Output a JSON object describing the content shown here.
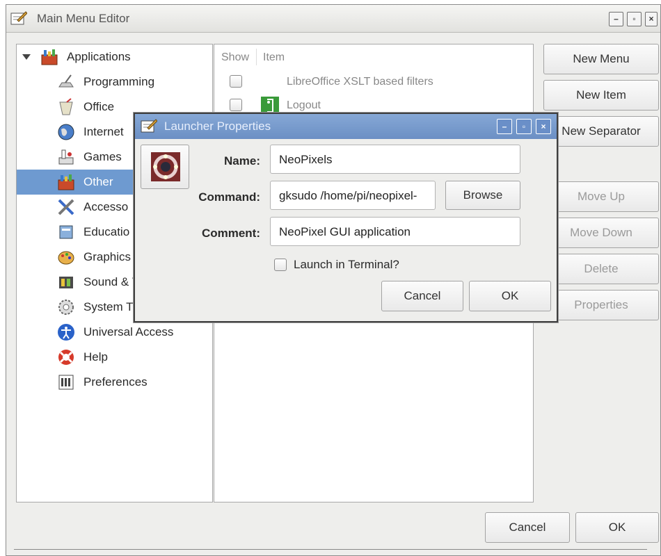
{
  "main_window": {
    "title": "Main Menu Editor",
    "controls": {
      "minimize": "–",
      "maximize": "▫",
      "close": "×"
    }
  },
  "tree": {
    "root": "Applications",
    "items": [
      {
        "label": "Programming",
        "icon": "programming-icon"
      },
      {
        "label": "Office",
        "icon": "office-icon"
      },
      {
        "label": "Internet",
        "icon": "internet-globe-icon"
      },
      {
        "label": "Games",
        "icon": "games-icon"
      },
      {
        "label": "Other",
        "icon": "other-icon",
        "selected": true
      },
      {
        "label": "Accesso",
        "icon": "accessories-icon"
      },
      {
        "label": "Educatio",
        "icon": "education-icon"
      },
      {
        "label": "Graphics",
        "icon": "graphics-icon"
      },
      {
        "label": "Sound & V",
        "icon": "sound-video-icon"
      },
      {
        "label": "System T",
        "icon": "system-tools-icon"
      },
      {
        "label": "Universal Access",
        "icon": "universal-access-icon"
      },
      {
        "label": "Help",
        "icon": "help-lifebuoy-icon"
      },
      {
        "label": "Preferences",
        "icon": "preferences-icon"
      }
    ]
  },
  "item_list": {
    "columns": {
      "show": "Show",
      "item": "Item"
    },
    "rows": [
      {
        "label": "LibreOffice XSLT based filters",
        "checked": false
      },
      {
        "label": "Logout",
        "checked": false
      }
    ]
  },
  "side_buttons": {
    "new_menu": "New Menu",
    "new_item": "New Item",
    "new_separator": "New Separator",
    "move_up": "Move Up",
    "move_down": "Move Down",
    "delete": "Delete",
    "properties": "Properties"
  },
  "dialog": {
    "title": "Launcher Properties",
    "controls": {
      "minimize": "–",
      "maximize": "▫",
      "close": "×"
    },
    "name_label": "Name:",
    "name_value": "NeoPixels",
    "command_label": "Command:",
    "command_value": "gksudo /home/pi/neopixel-",
    "browse": "Browse",
    "comment_label": "Comment:",
    "comment_value": "NeoPixel GUI application",
    "terminal_label": "Launch in Terminal?",
    "terminal_checked": false,
    "cancel": "Cancel",
    "ok": "OK"
  },
  "footer": {
    "cancel": "Cancel",
    "ok": "OK"
  },
  "colors": {
    "selection": "#6e9ad0",
    "dialog_titlebar": "#7a9ccf",
    "window_bg": "#eeeeec"
  }
}
